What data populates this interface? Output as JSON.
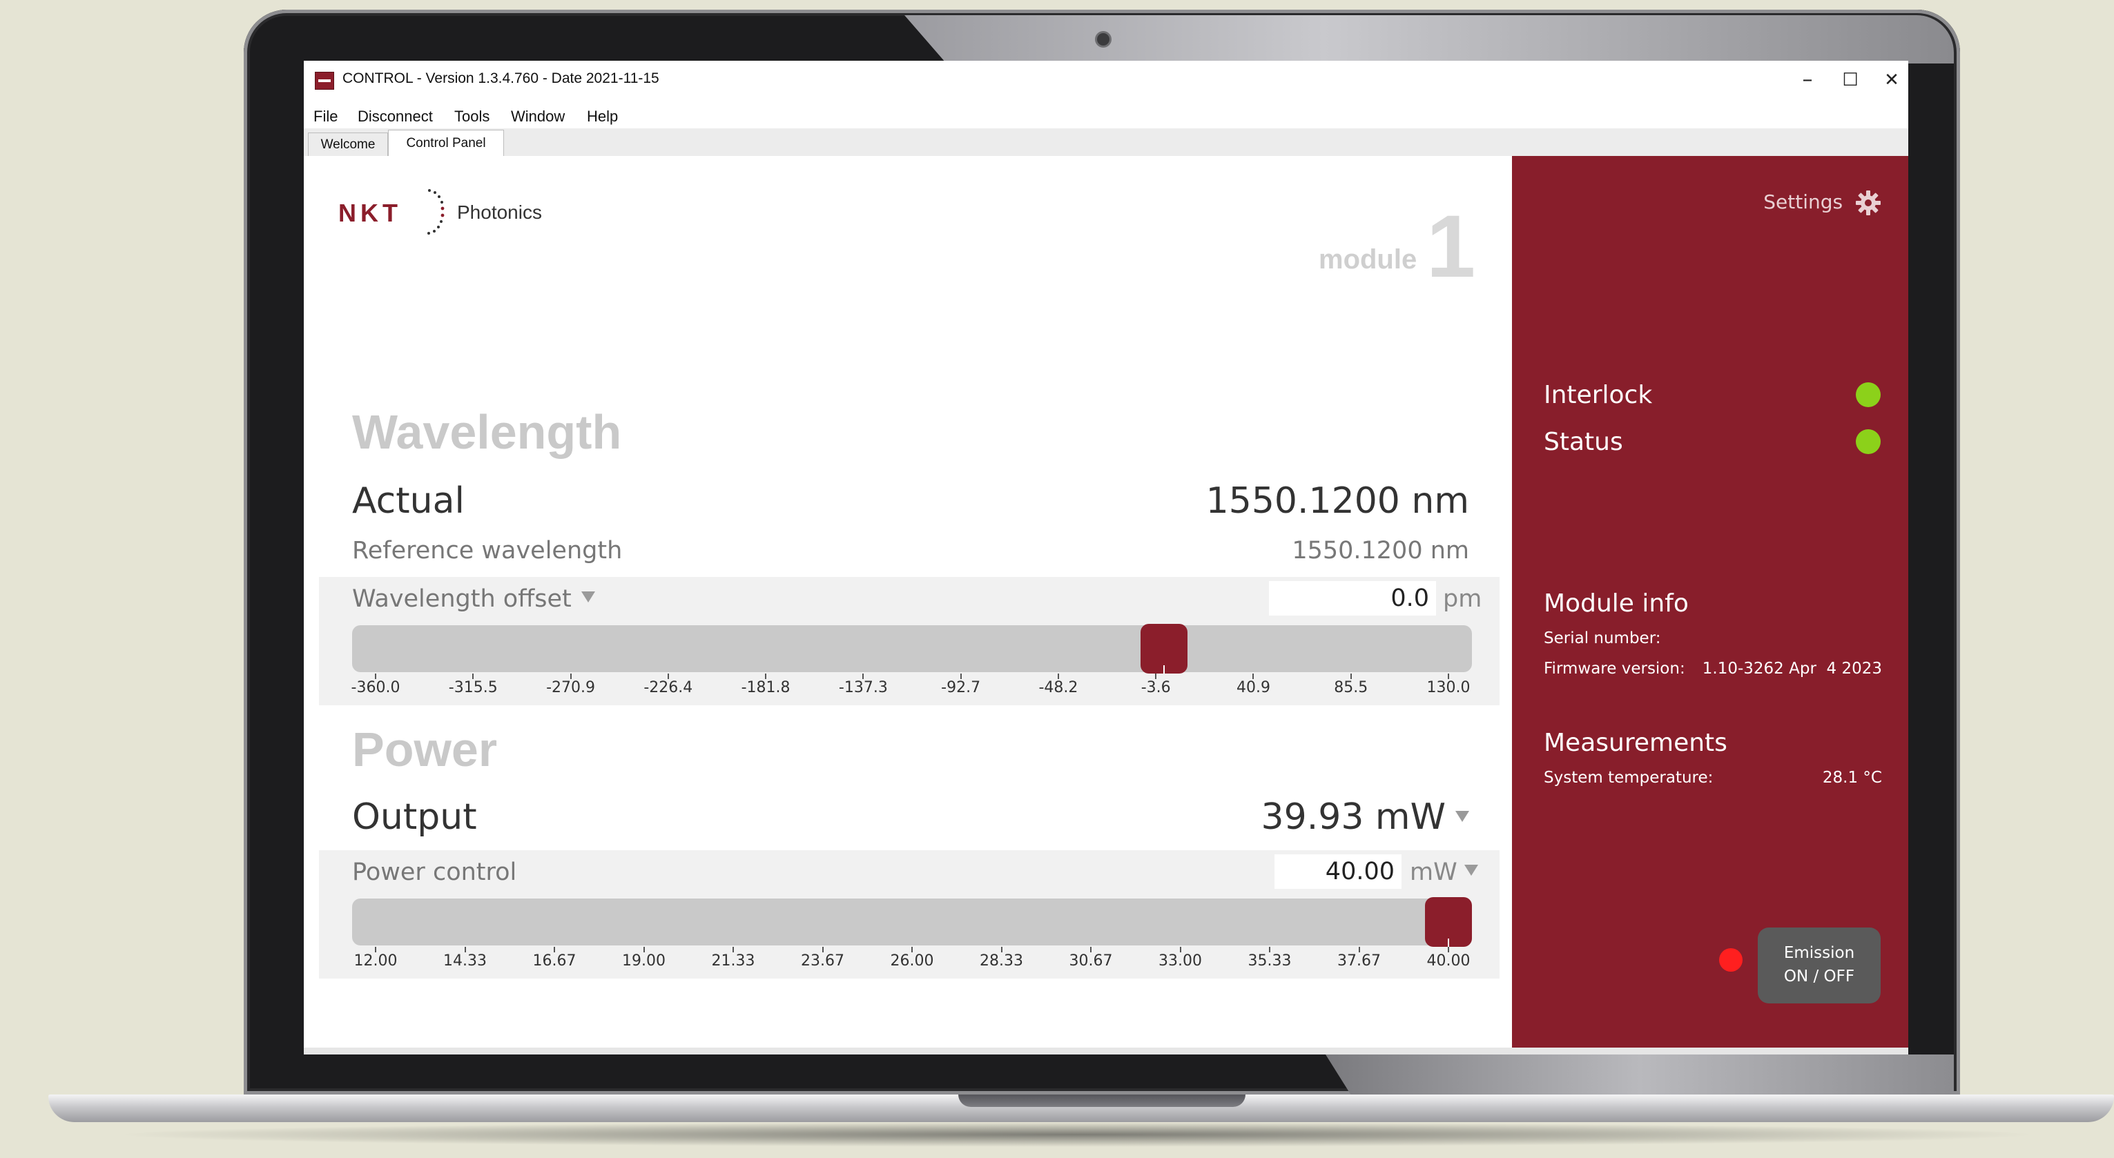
{
  "window": {
    "title": "CONTROL - Version 1.3.4.760 - Date 2021-11-15",
    "minimize": "–",
    "maximize": "☐",
    "close": "✕"
  },
  "menu": [
    "File",
    "Disconnect",
    "Tools",
    "Window",
    "Help"
  ],
  "tabs": [
    {
      "label": "Welcome",
      "active": false
    },
    {
      "label": "Control Panel",
      "active": true
    }
  ],
  "logo": {
    "brand": "NKT",
    "sub": "Photonics"
  },
  "module": {
    "label": "module",
    "number": "1"
  },
  "wavelength": {
    "title": "Wavelength",
    "actual_label": "Actual",
    "actual_value": "1550.1200 nm",
    "reference_label": "Reference wavelength",
    "reference_value": "1550.1200 nm",
    "offset_label": "Wavelength offset",
    "offset_value": "0.0",
    "offset_unit": "pm",
    "slider": {
      "min": -360.0,
      "max": 130.0,
      "value": 0.0,
      "ticks": [
        "-360.0",
        "-315.5",
        "-270.9",
        "-226.4",
        "-181.8",
        "-137.3",
        "-92.7",
        "-48.2",
        "-3.6",
        "40.9",
        "85.5",
        "130.0"
      ]
    }
  },
  "power": {
    "title": "Power",
    "output_label": "Output",
    "output_value": "39.93 mW",
    "control_label": "Power control",
    "control_value": "40.00",
    "control_unit": "mW",
    "slider": {
      "min": 12.0,
      "max": 40.0,
      "value": 40.0,
      "ticks": [
        "12.00",
        "14.33",
        "16.67",
        "19.00",
        "21.33",
        "23.67",
        "26.00",
        "28.33",
        "30.67",
        "33.00",
        "35.33",
        "37.67",
        "40.00"
      ]
    }
  },
  "side": {
    "settings_label": "Settings",
    "interlock_label": "Interlock",
    "status_label": "Status",
    "led_ok_color": "#8cd11a",
    "module_info_title": "Module info",
    "serial_label": "Serial number:",
    "serial_value": "",
    "firmware_label": "Firmware version:",
    "firmware_value": "1.10-3262 Apr  4 2023",
    "measurements_title": "Measurements",
    "temp_label": "System temperature:",
    "temp_value": "28.1 °C",
    "emission_line1": "Emission",
    "emission_line2": "ON / OFF",
    "emission_led_color": "#ff1f1f"
  },
  "colors": {
    "accent": "#881e2b",
    "panel_bg": "#f1f1f1"
  }
}
